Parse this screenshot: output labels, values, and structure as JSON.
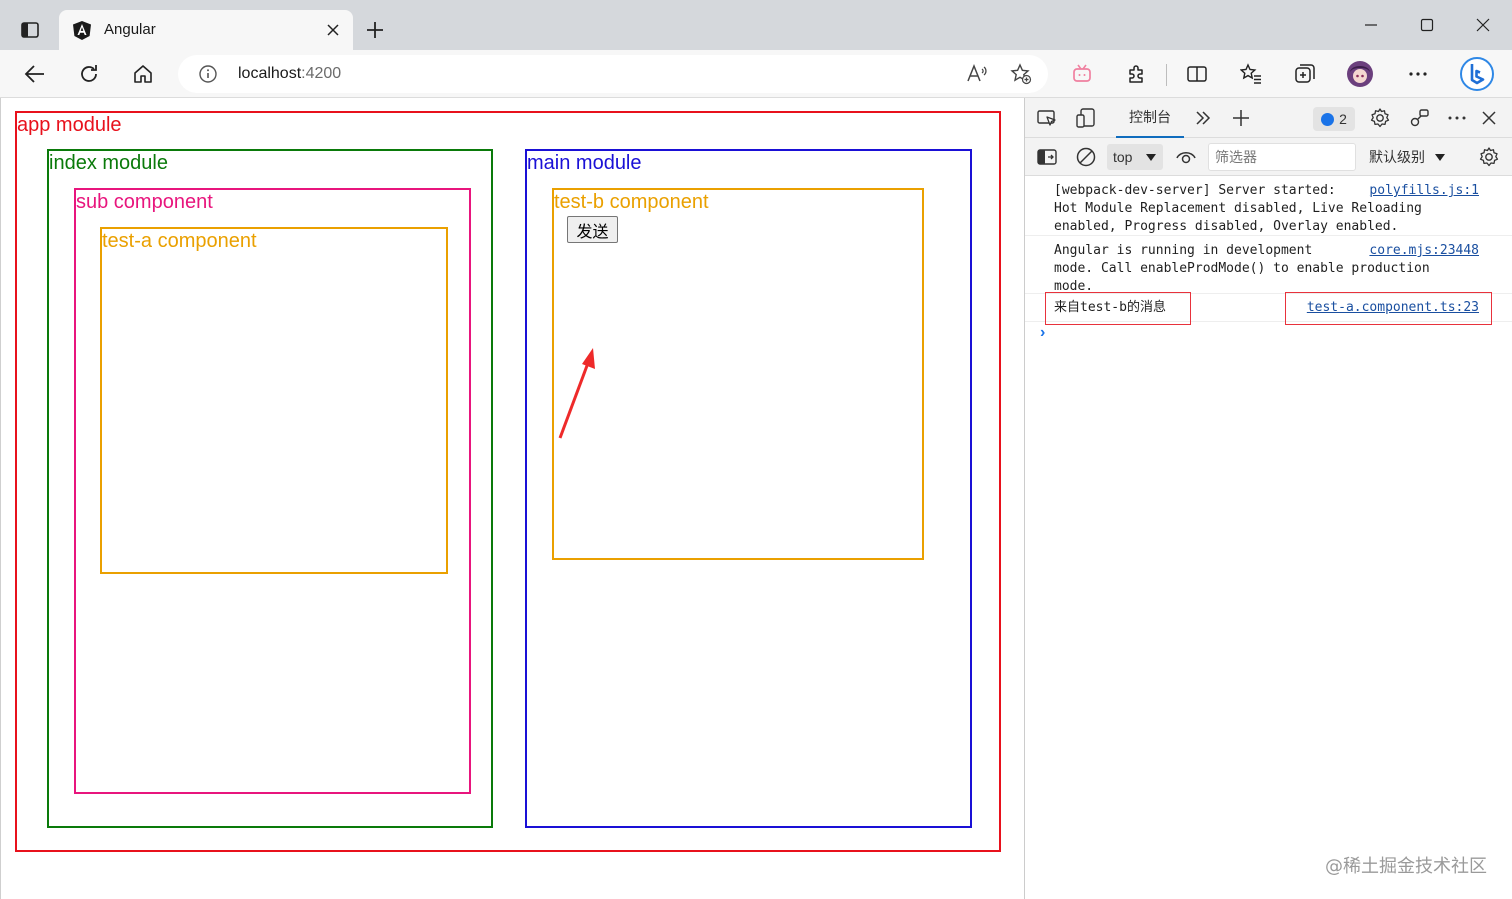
{
  "browser": {
    "tab": {
      "title": "Angular"
    },
    "address": {
      "host": "localhost",
      "port": ":4200"
    }
  },
  "page": {
    "app_module": {
      "label": "app module",
      "color": "#e8111c"
    },
    "index_module": {
      "label": "index module",
      "color": "#0a7a0a"
    },
    "sub_component": {
      "label": "sub component",
      "color": "#e8157d"
    },
    "test_a_component": {
      "label": "test-a component",
      "color": "#eaa000"
    },
    "main_module": {
      "label": "main module",
      "color": "#1a10d6"
    },
    "test_b_component": {
      "label": "test-b component",
      "color": "#eaa000"
    },
    "send_button": {
      "label": "发送"
    }
  },
  "devtools": {
    "console_tab": "控制台",
    "issues_count": "2",
    "context": "top",
    "filter_placeholder": "筛选器",
    "levels": "默认级别",
    "messages": [
      {
        "text": "[webpack-dev-server] Server started:\nHot Module Replacement disabled, Live Reloading\nenabled, Progress disabled, Overlay enabled.",
        "source": "polyfills.js:1"
      },
      {
        "text": "Angular is running in development\nmode. Call enableProdMode() to enable production\nmode.",
        "source": "core.mjs:23448"
      },
      {
        "text": "来自test-b的消息",
        "source": "test-a.component.ts:23"
      }
    ],
    "highlight_color": "#e8323c"
  },
  "watermark": "@稀土掘金技术社区"
}
